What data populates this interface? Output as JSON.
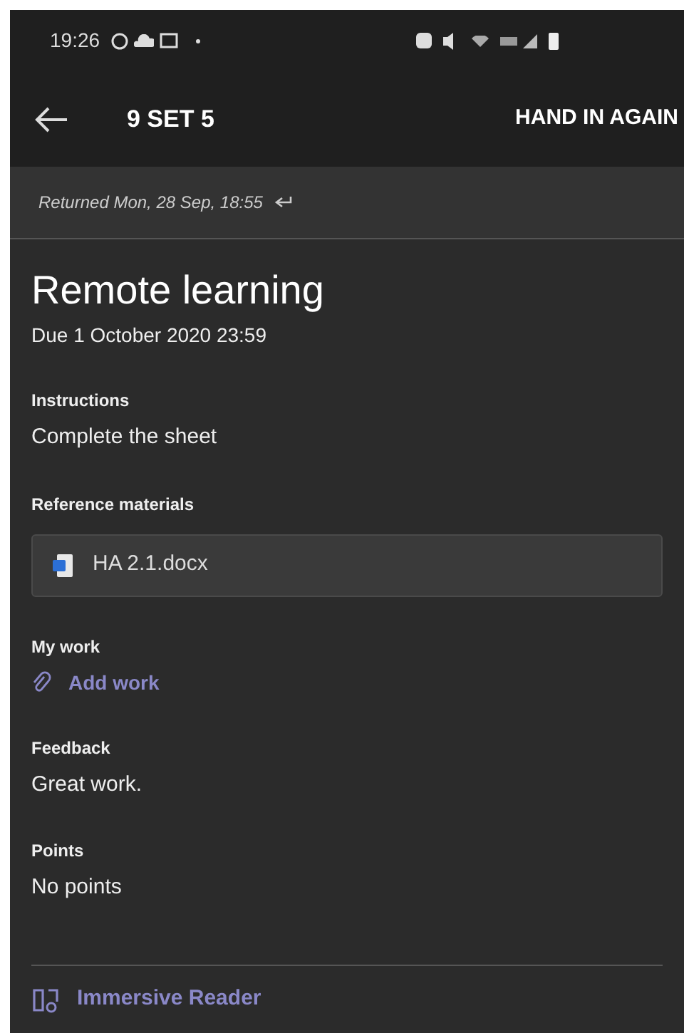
{
  "status_bar": {
    "time": "19:26"
  },
  "header": {
    "title": "9 SET 5",
    "action": "HAND IN AGAIN"
  },
  "returned": "Returned Mon, 28 Sep, 18:55",
  "assignment": {
    "title": "Remote learning",
    "due": "Due 1 October 2020 23:59"
  },
  "sections": [
    {
      "kind": "text",
      "label": "Instructions",
      "value": "Complete the sheet"
    },
    {
      "kind": "files",
      "label": "Reference materials",
      "files": [
        "HA 2.1.docx"
      ]
    },
    {
      "kind": "link",
      "label": "My work",
      "value": "Add work"
    },
    {
      "kind": "text",
      "label": "Feedback",
      "value": "Great work."
    },
    {
      "kind": "text",
      "label": "Points",
      "value": "No points"
    }
  ],
  "footer": {
    "link": "Immersive Reader"
  }
}
